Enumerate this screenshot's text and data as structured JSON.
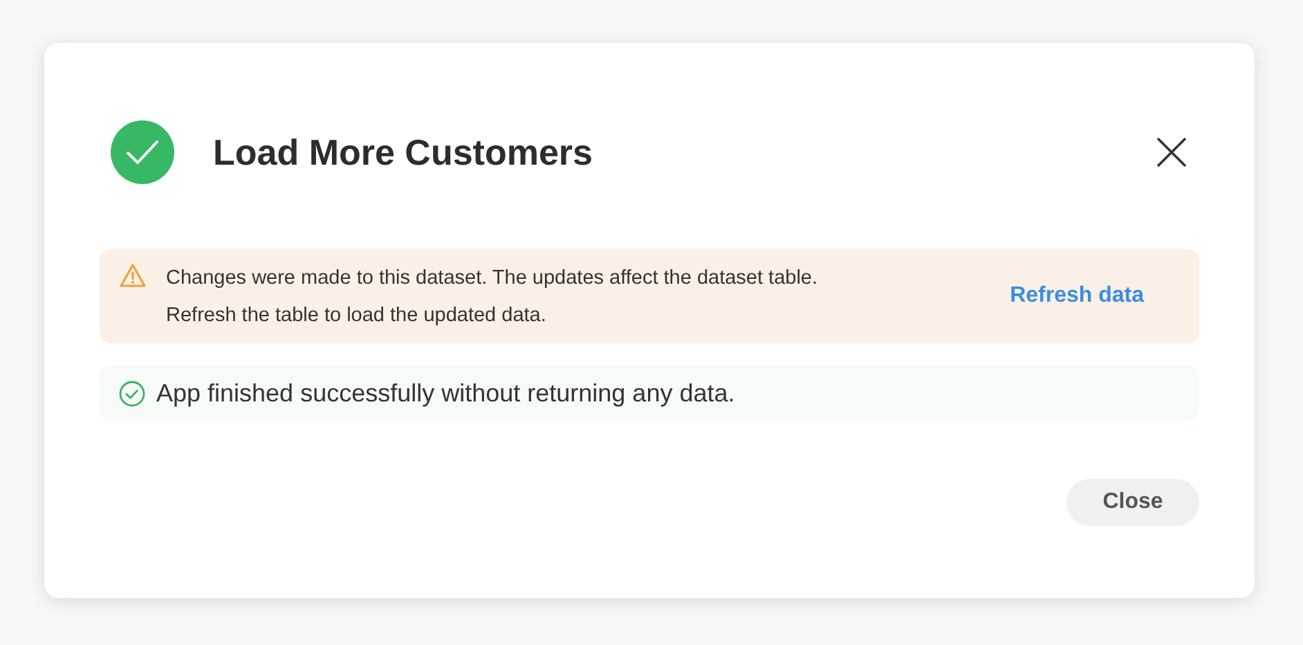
{
  "dialog": {
    "title": "Load More Customers",
    "kind": "success"
  },
  "messages": [
    {
      "kind": "warning",
      "lines": [
        "Changes were made to this dataset. The updates affect the dataset table.",
        "Refresh the table to load the updated data."
      ],
      "action": "Refresh data"
    },
    {
      "kind": "success",
      "lines": [
        "App finished successfully without returning any data."
      ]
    }
  ],
  "buttons": [
    "Close"
  ]
}
